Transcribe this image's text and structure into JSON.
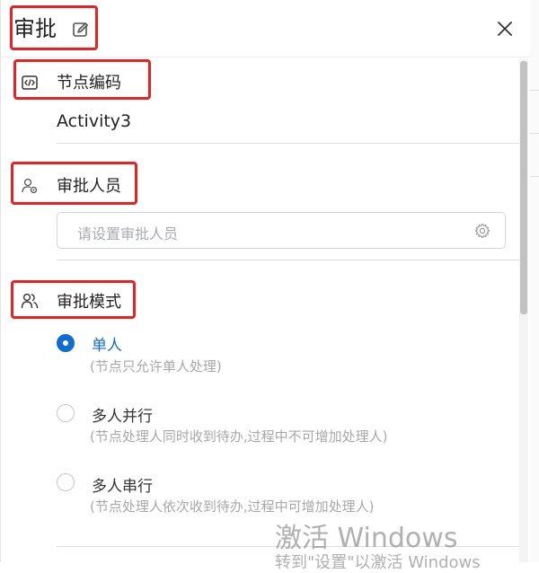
{
  "header": {
    "title": "审批",
    "edit_icon": "edit-icon",
    "close_icon": "close-icon"
  },
  "sections": {
    "node_code": {
      "label": "节点编码",
      "icon": "code-icon",
      "value": "Activity3"
    },
    "approvers": {
      "label": "审批人员",
      "icon": "user-settings-icon",
      "placeholder": "请设置审批人员",
      "field_icon": "gear-icon"
    },
    "mode": {
      "label": "审批模式",
      "icon": "users-icon",
      "options": [
        {
          "label": "单人",
          "desc": "(节点只允许单人处理)",
          "checked": true
        },
        {
          "label": "多人并行",
          "desc": "(节点处理人同时收到待办,过程中不可增加处理人)",
          "checked": false
        },
        {
          "label": "多人串行",
          "desc": "(节点处理人依次收到待办,过程中可增加处理人)",
          "checked": false
        }
      ]
    }
  },
  "colors": {
    "accent": "#0f6cd1",
    "highlight_box": "#e82222"
  },
  "watermark": {
    "line1": "激活 Windows",
    "line2": "转到\"设置\"以激活 Windows"
  }
}
